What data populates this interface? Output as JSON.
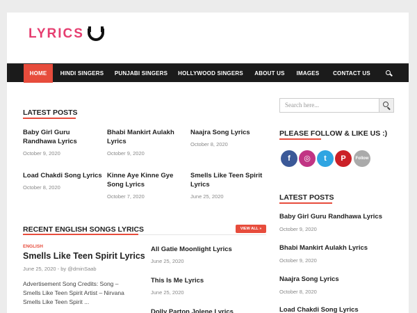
{
  "logo": {
    "text": "LYRICS"
  },
  "nav": {
    "items": [
      {
        "label": "HOME",
        "active": true
      },
      {
        "label": "HINDI SINGERS"
      },
      {
        "label": "PUNJABI SINGERS"
      },
      {
        "label": "HOLLYWOOD SINGERS"
      },
      {
        "label": "ABOUT US"
      },
      {
        "label": "IMAGES"
      },
      {
        "label": "CONTACT US"
      }
    ]
  },
  "latest_posts": {
    "title": "LATEST POSTS",
    "posts": [
      {
        "title_l1": "Baby Girl Guru",
        "title_l2": "Randhawa Lyrics",
        "date": "October 9, 2020"
      },
      {
        "title_l1": "Bhabi Mankirt Aulakh",
        "title_l2": "Lyrics",
        "date": "October 9, 2020"
      },
      {
        "title_l1": "Naajra Song Lyrics",
        "title_l2": "",
        "date": "October 8, 2020"
      },
      {
        "title_l1": "Load Chakdi Song Lyrics",
        "title_l2": "",
        "date": "October 8, 2020"
      },
      {
        "title_l1": "Kinne Aye Kinne Gye",
        "title_l2": "Song Lyrics",
        "date": "October 7, 2020"
      },
      {
        "title_l1": "Smells Like Teen Spirit",
        "title_l2": "Lyrics",
        "date": "June 25, 2020"
      }
    ]
  },
  "recent_english": {
    "title": "RECENT ENGLISH SONGS LYRICS",
    "view_all": "VIEW ALL »",
    "featured": {
      "category": "ENGLISH",
      "title": "Smells Like Teen Spirit Lyrics",
      "date": "June 25, 2020",
      "by": " - by ",
      "author": "@dminSaab",
      "excerpt_l1": "Advertisement Song Credits: Song –",
      "excerpt_l2": "Smells Like Teen Spirit Artist – Nirvana",
      "excerpt_l3": "Smells Like Teen Spirit ..."
    },
    "list": [
      {
        "title": "All Gatie Moonlight Lyrics",
        "date": "June 25, 2020"
      },
      {
        "title": "This Is Me Lyrics",
        "date": "June 25, 2020"
      },
      {
        "title": "Dolly Parton Jolene Lyrics",
        "date": ""
      }
    ]
  },
  "sidebar": {
    "search_placeholder": "Search here...",
    "follow_title": "PLEASE FOLLOW & LIKE US :)",
    "social": [
      {
        "name": "facebook",
        "glyph": "f"
      },
      {
        "name": "instagram",
        "glyph": "◎"
      },
      {
        "name": "twitter",
        "glyph": "t"
      },
      {
        "name": "pinterest",
        "glyph": "P"
      },
      {
        "name": "follow",
        "glyph": "Follow"
      }
    ],
    "latest_title": "LATEST POSTS",
    "latest": [
      {
        "title": "Baby Girl Guru Randhawa Lyrics",
        "date": "October 9, 2020"
      },
      {
        "title": "Bhabi Mankirt Aulakh Lyrics",
        "date": "October 9, 2020"
      },
      {
        "title": "Naajra Song Lyrics",
        "date": "October 8, 2020"
      },
      {
        "title": "Load Chakdi Song Lyrics",
        "date": ""
      }
    ]
  },
  "colors": {
    "accent": "#e74c3c",
    "logo": "#e63e70",
    "nav_bg": "#1b1b1b"
  }
}
